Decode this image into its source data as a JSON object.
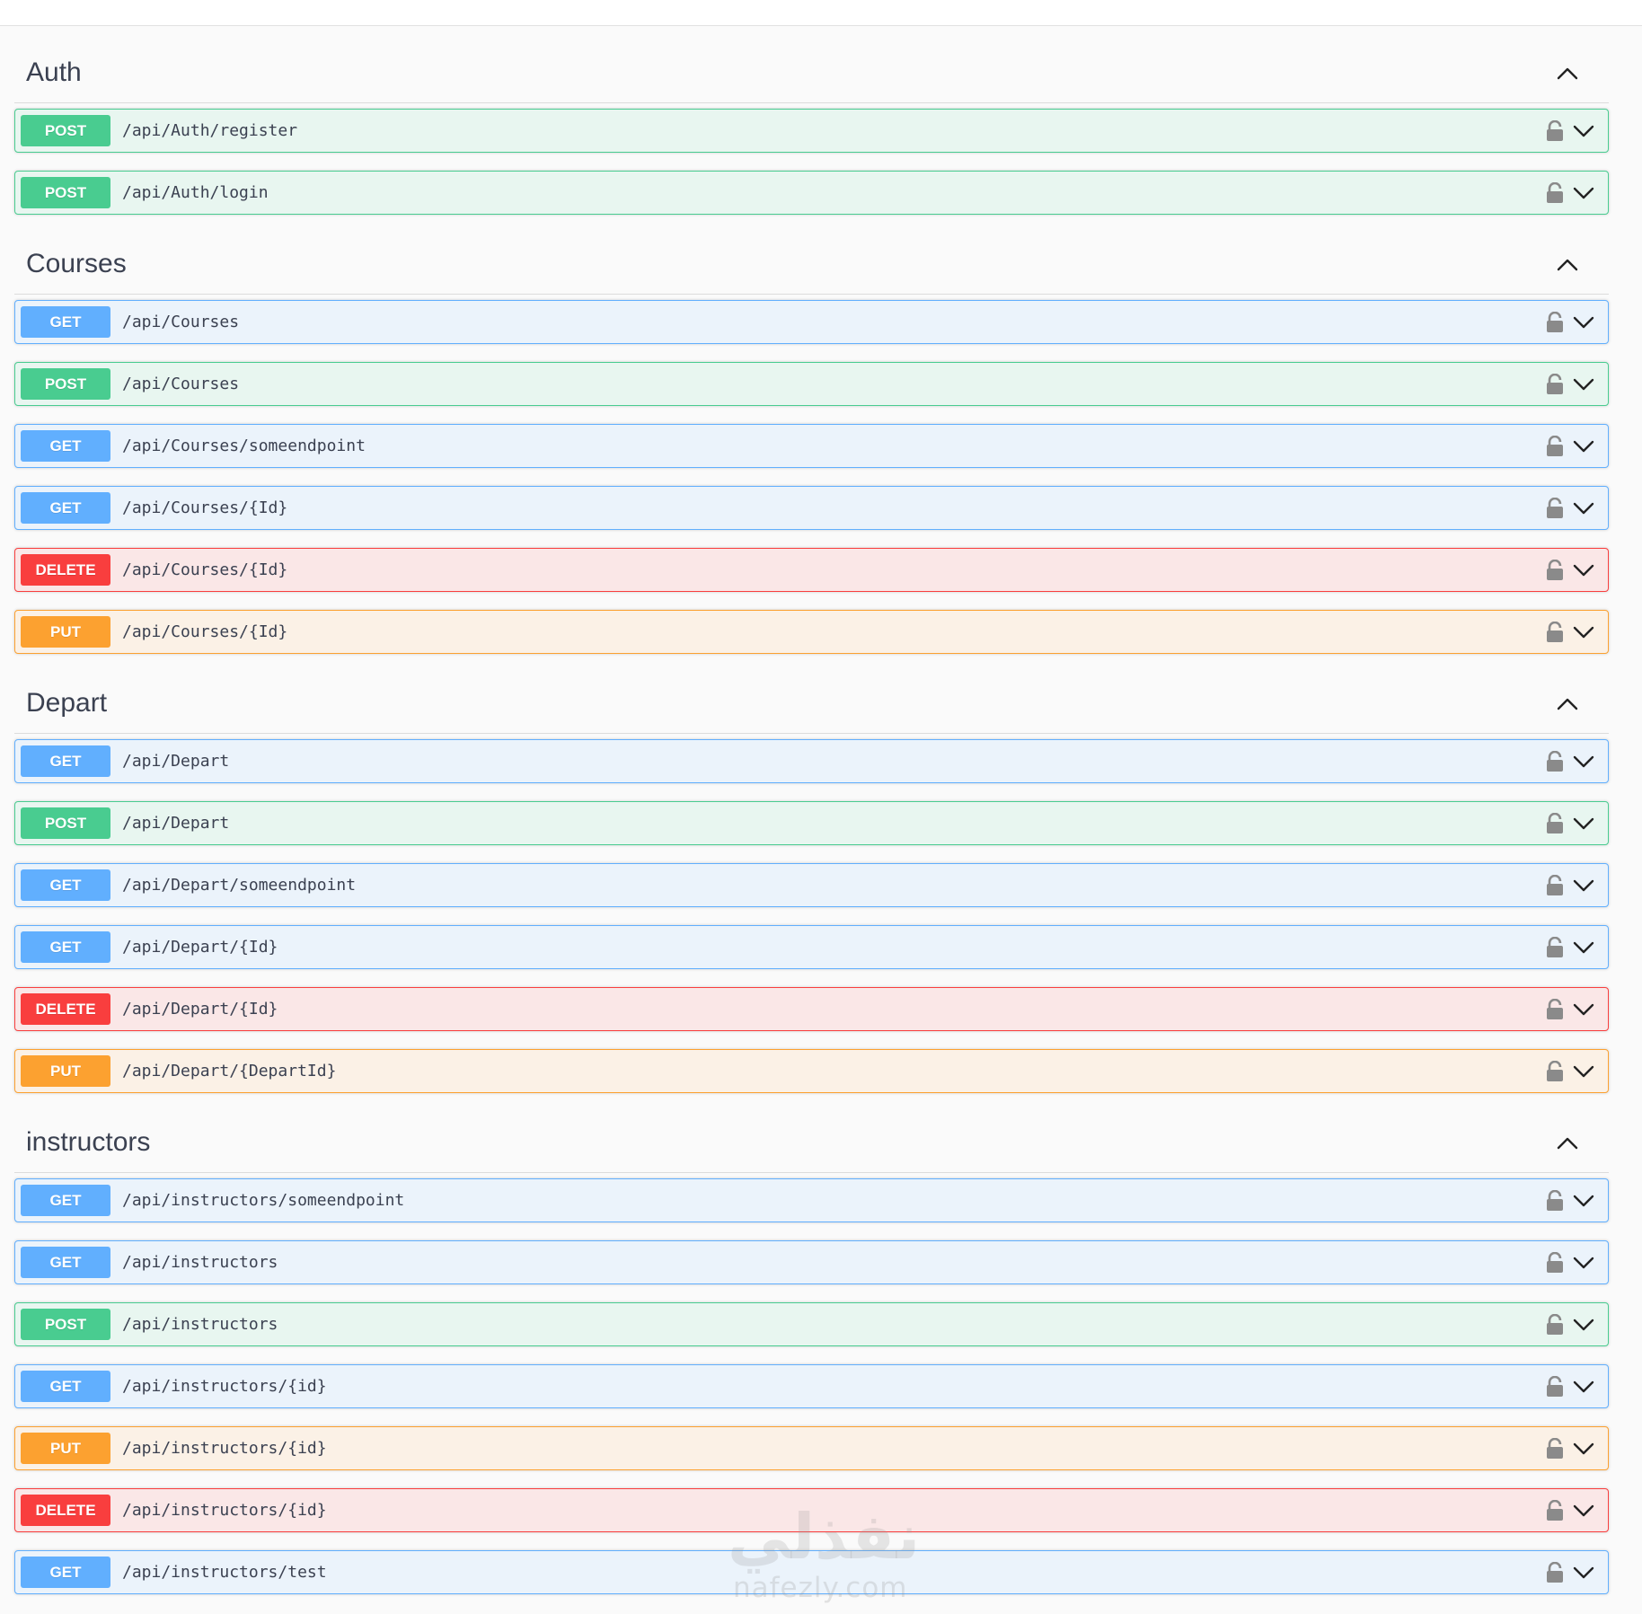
{
  "sections": [
    {
      "title": "Auth",
      "operations": [
        {
          "method": "POST",
          "path": "/api/Auth/register"
        },
        {
          "method": "POST",
          "path": "/api/Auth/login"
        }
      ]
    },
    {
      "title": "Courses",
      "operations": [
        {
          "method": "GET",
          "path": "/api/Courses"
        },
        {
          "method": "POST",
          "path": "/api/Courses"
        },
        {
          "method": "GET",
          "path": "/api/Courses/someendpoint"
        },
        {
          "method": "GET",
          "path": "/api/Courses/{Id}"
        },
        {
          "method": "DELETE",
          "path": "/api/Courses/{Id}"
        },
        {
          "method": "PUT",
          "path": "/api/Courses/{Id}"
        }
      ]
    },
    {
      "title": "Depart",
      "operations": [
        {
          "method": "GET",
          "path": "/api/Depart"
        },
        {
          "method": "POST",
          "path": "/api/Depart"
        },
        {
          "method": "GET",
          "path": "/api/Depart/someendpoint"
        },
        {
          "method": "GET",
          "path": "/api/Depart/{Id}"
        },
        {
          "method": "DELETE",
          "path": "/api/Depart/{Id}"
        },
        {
          "method": "PUT",
          "path": "/api/Depart/{DepartId}"
        }
      ]
    },
    {
      "title": "instructors",
      "operations": [
        {
          "method": "GET",
          "path": "/api/instructors/someendpoint"
        },
        {
          "method": "GET",
          "path": "/api/instructors"
        },
        {
          "method": "POST",
          "path": "/api/instructors"
        },
        {
          "method": "GET",
          "path": "/api/instructors/{id}"
        },
        {
          "method": "PUT",
          "path": "/api/instructors/{id}"
        },
        {
          "method": "DELETE",
          "path": "/api/instructors/{id}"
        },
        {
          "method": "GET",
          "path": "/api/instructors/test"
        }
      ]
    }
  ],
  "icons": {
    "section_toggle": "chevron-up-icon",
    "lock": "lock-icon",
    "expand": "chevron-down-icon"
  },
  "colors": {
    "GET": "#61affe",
    "POST": "#49cc90",
    "DELETE": "#f93e3e",
    "PUT": "#fca130"
  },
  "watermark": {
    "arabic": "نفذلي",
    "latin": "nafezly.com"
  }
}
